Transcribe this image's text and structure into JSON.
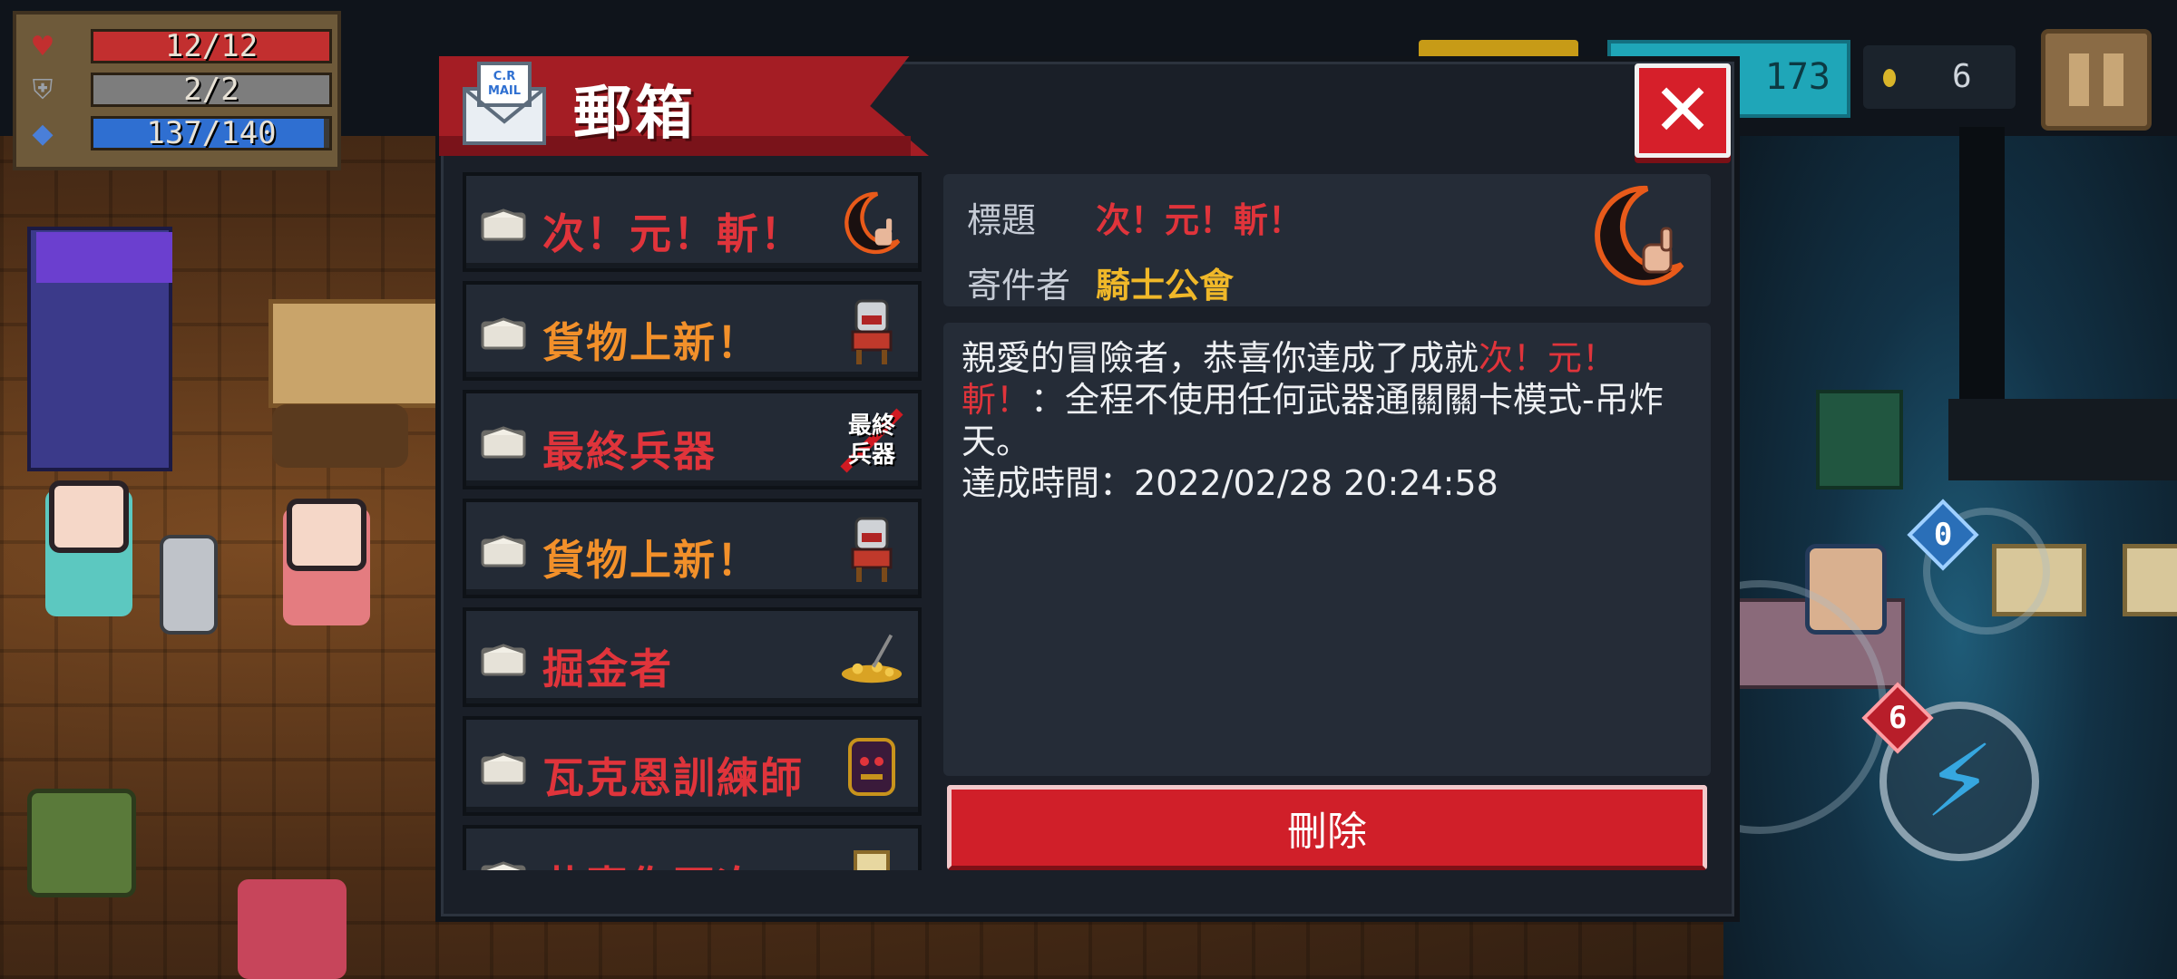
{
  "hud": {
    "health": {
      "text": "12/12",
      "value": 12,
      "max": 12,
      "color": "#c22f2f"
    },
    "armor": {
      "text": "2/2",
      "value": 2,
      "max": 2,
      "color": "#8a8a8a"
    },
    "energy": {
      "text": "137/140",
      "value": 137,
      "max": 140,
      "color": "#2f6fd1"
    },
    "gems_text": "173",
    "coins_text": "6",
    "skill_badge_top": "0",
    "skill_badge_bottom": "6"
  },
  "mailbox": {
    "title": "郵箱",
    "icon_text": "C.R MAIL",
    "close_label": "✕",
    "items": [
      {
        "label": "次！元！斬！",
        "color": "#e0343b",
        "thumb_icon": "crescent-blade-icon"
      },
      {
        "label": "貨物上新！",
        "color": "#f2902a",
        "thumb_icon": "merchant-icon"
      },
      {
        "label": "最終兵器",
        "color": "#e0343b",
        "thumb_icon": "ultimate-weapon-icon",
        "thumb_text": "最終兵器"
      },
      {
        "label": "貨物上新！",
        "color": "#f2902a",
        "thumb_icon": "merchant-icon"
      },
      {
        "label": "掘金者",
        "color": "#e0343b",
        "thumb_icon": "gold-pile-icon"
      },
      {
        "label": "瓦克恩訓練師",
        "color": "#e0343b",
        "thumb_icon": "trainer-icon"
      },
      {
        "label": "恭喜你再次",
        "color": "#e0343b",
        "thumb_icon": "scroll-icon"
      }
    ],
    "detail": {
      "subject_label": "標題",
      "subject_value": "次！元！斬！",
      "sender_label": "寄件者",
      "sender_value": "騎士公會",
      "body_prefix": "親愛的冒險者，恭喜你達成了成就",
      "body_highlight_1": "次！元！",
      "body_highlight_2": "斬！",
      "body_suffix": "：全程不使用任何武器通關關卡模式-吊炸天。",
      "time_line": "達成時間：2022/02/28 20:24:58",
      "delete_label": "刪除"
    }
  },
  "colors": {
    "accent_red": "#d01f29",
    "orange": "#f2902a",
    "gold_text": "#f0b829",
    "panel": "#1a1f28"
  }
}
